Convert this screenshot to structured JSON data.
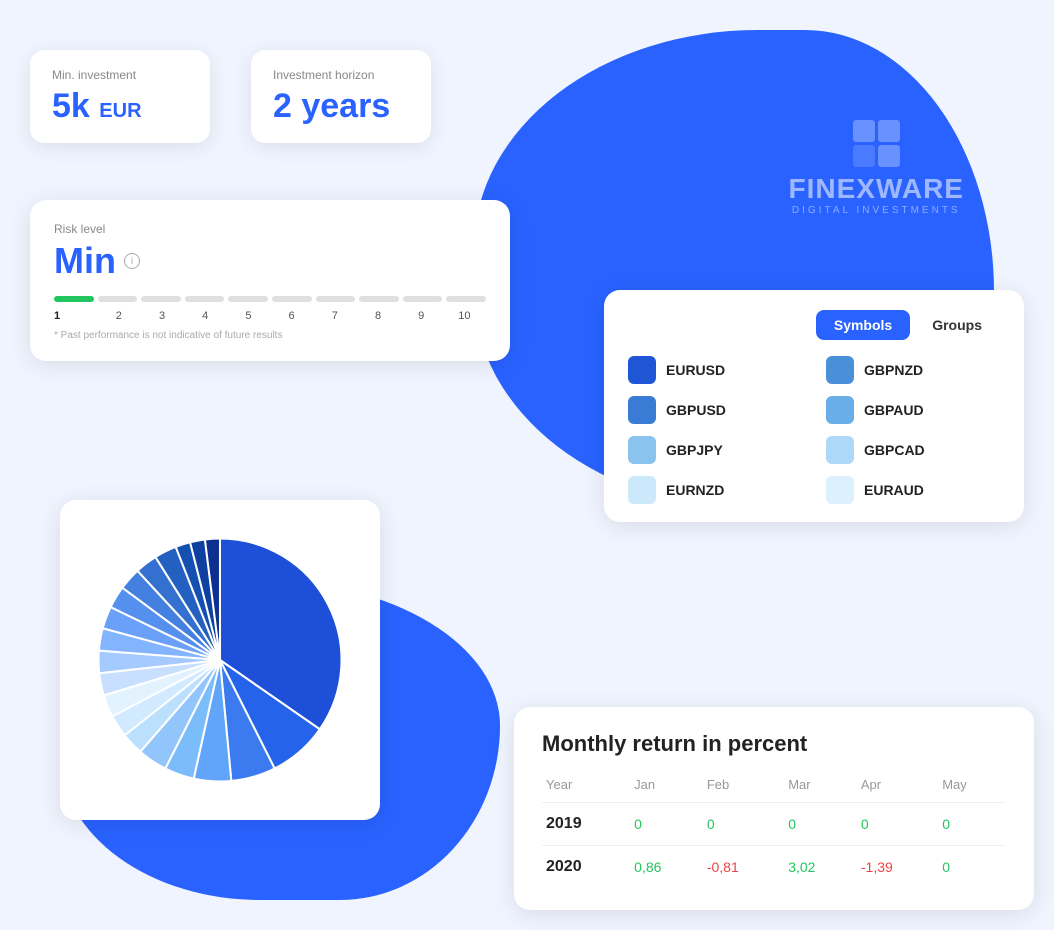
{
  "blobs": {
    "top": true,
    "bottom": true
  },
  "logo": {
    "name": "FINEXWARE",
    "subtitle": "Digital Investments"
  },
  "min_investment": {
    "label": "Min. investment",
    "value": "5k",
    "unit": "EUR"
  },
  "horizon": {
    "label": "Investment horizon",
    "value": "2 years"
  },
  "risk": {
    "label": "Risk level",
    "value": "Min",
    "info": "i",
    "active_segment": 1,
    "total_segments": 10,
    "numbers": [
      "1",
      "2",
      "3",
      "4",
      "5",
      "6",
      "7",
      "8",
      "9",
      "10"
    ],
    "disclaimer": "* Past performance is not indicative of future results"
  },
  "symbols_tabs": {
    "active": "Symbols",
    "inactive": "Groups"
  },
  "symbols": [
    {
      "name": "EURUSD",
      "color": "#1e56d6"
    },
    {
      "name": "GBPNZD",
      "color": "#4a90d9"
    },
    {
      "name": "GBPUSD",
      "color": "#3a7bd5"
    },
    {
      "name": "GBPAUD",
      "color": "#6aaee8"
    },
    {
      "name": "GBPJPY",
      "color": "#8ac4ee"
    },
    {
      "name": "GBPCAD",
      "color": "#add8f7"
    },
    {
      "name": "EURNZD",
      "color": "#cce8fb"
    },
    {
      "name": "EURAUD",
      "color": "#ddf0fd"
    }
  ],
  "monthly_return": {
    "title": "Monthly return in percent",
    "columns": [
      "Year",
      "Jan",
      "Feb",
      "Mar",
      "Apr",
      "May"
    ],
    "rows": [
      {
        "year": "2019",
        "values": [
          {
            "v": "0",
            "type": "zero"
          },
          {
            "v": "0",
            "type": "zero"
          },
          {
            "v": "0",
            "type": "zero"
          },
          {
            "v": "0",
            "type": "zero"
          },
          {
            "v": "0",
            "type": "zero"
          }
        ]
      },
      {
        "year": "2020",
        "values": [
          {
            "v": "0,86",
            "type": "green"
          },
          {
            "v": "-0,81",
            "type": "red"
          },
          {
            "v": "3,02",
            "type": "green"
          },
          {
            "v": "-1,39",
            "type": "red"
          },
          {
            "v": "0",
            "type": "zero"
          }
        ]
      }
    ]
  },
  "pie": {
    "slices": [
      {
        "pct": 35,
        "color": "#1e4fd8"
      },
      {
        "pct": 8,
        "color": "#2563eb"
      },
      {
        "pct": 6,
        "color": "#3b7bef"
      },
      {
        "pct": 5,
        "color": "#60a5fa"
      },
      {
        "pct": 4,
        "color": "#7bbcfa"
      },
      {
        "pct": 4,
        "color": "#93c5fd"
      },
      {
        "pct": 3,
        "color": "#bae0fd"
      },
      {
        "pct": 3,
        "color": "#d1eaff"
      },
      {
        "pct": 3,
        "color": "#e2f2ff"
      },
      {
        "pct": 3,
        "color": "#c8dfff"
      },
      {
        "pct": 3,
        "color": "#a5caff"
      },
      {
        "pct": 3,
        "color": "#82b4ff"
      },
      {
        "pct": 3,
        "color": "#6aa0f8"
      },
      {
        "pct": 3,
        "color": "#5590ee"
      },
      {
        "pct": 3,
        "color": "#4480e0"
      },
      {
        "pct": 3,
        "color": "#3470d0"
      },
      {
        "pct": 3,
        "color": "#2460c0"
      },
      {
        "pct": 2,
        "color": "#1450b0"
      },
      {
        "pct": 2,
        "color": "#0f40a0"
      },
      {
        "pct": 2,
        "color": "#0d3090"
      }
    ]
  }
}
